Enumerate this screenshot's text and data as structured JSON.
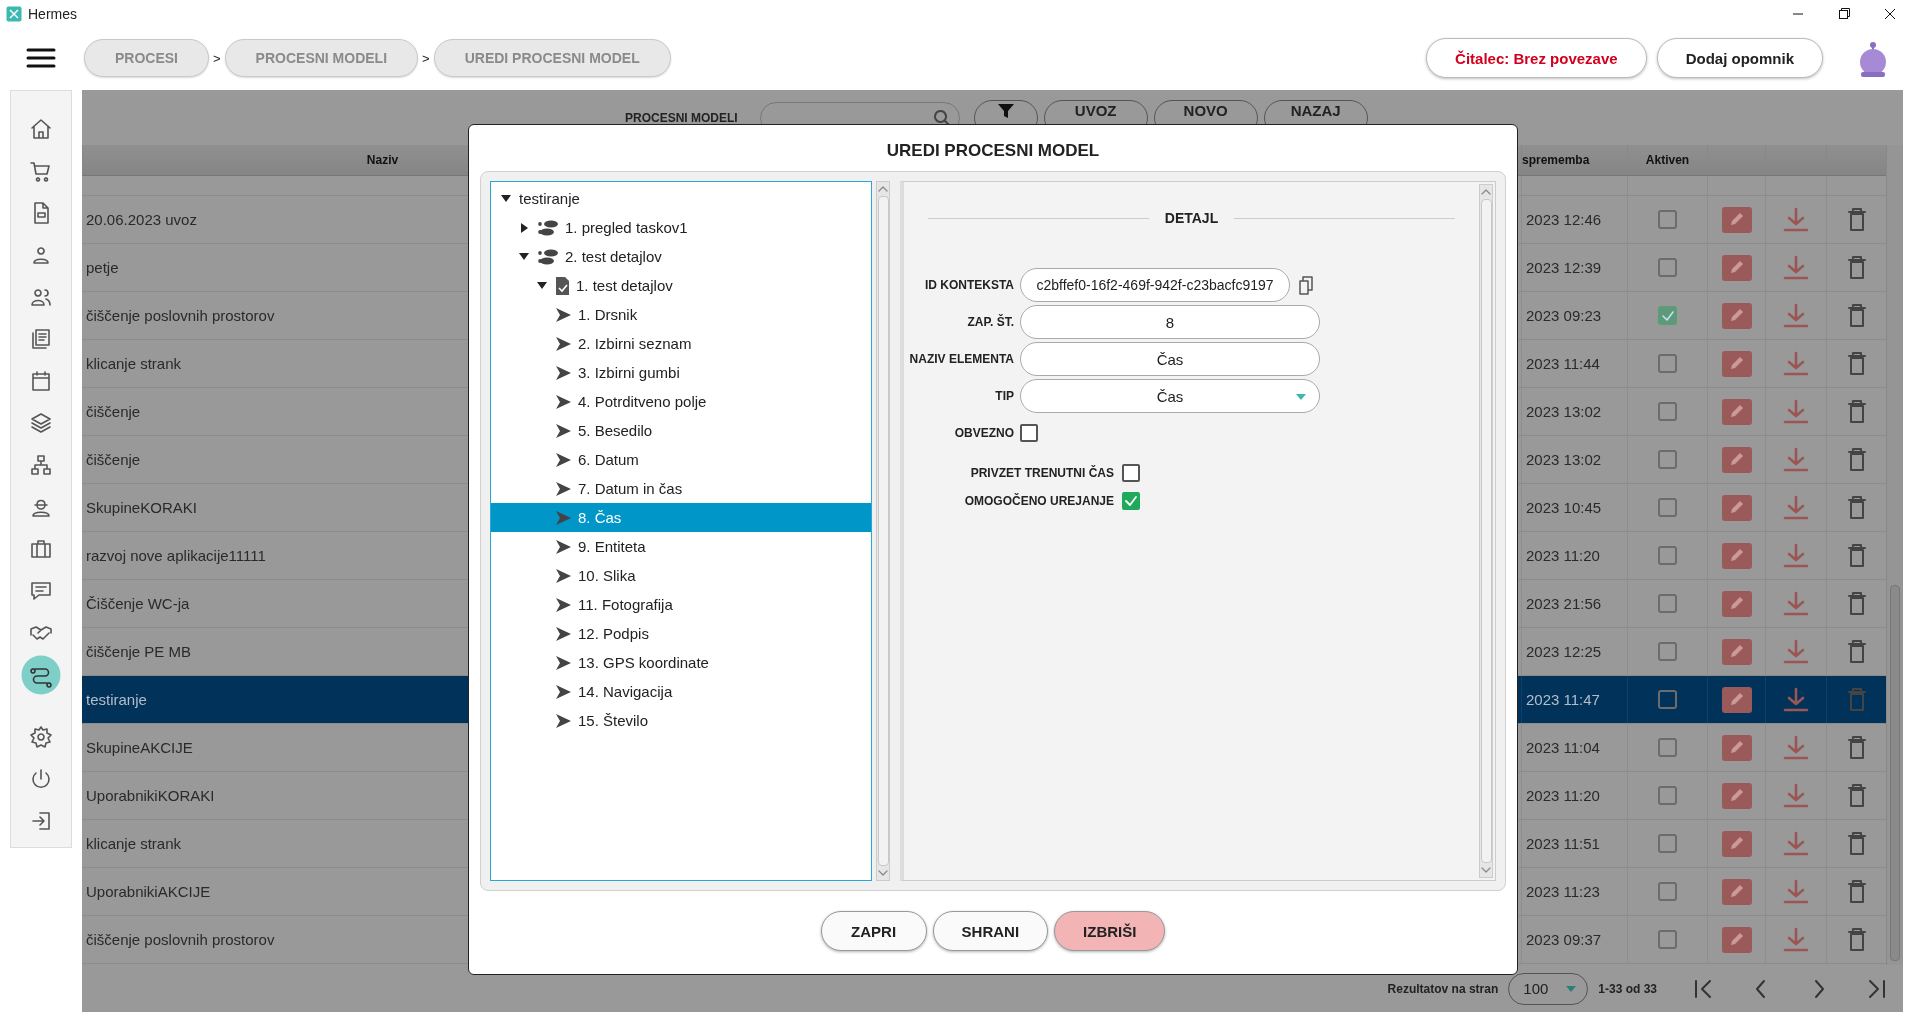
{
  "window": {
    "title": "Hermes"
  },
  "breadcrumbs": [
    {
      "label": "PROCESI"
    },
    {
      "separator": ">",
      "label": "PROCESNI MODELI"
    },
    {
      "separator": ">",
      "label": "UREDI PROCESNI MODEL"
    }
  ],
  "header_buttons": [
    {
      "label": "Čitalec: Brez povezave",
      "kind": "alert"
    },
    {
      "label": "Dodaj opomnik",
      "kind": "plain"
    }
  ],
  "sidebar": {
    "items": [
      {
        "selected": false
      },
      {
        "selected": false
      },
      {
        "selected": false
      },
      {
        "selected": false
      },
      {
        "selected": false
      },
      {
        "selected": false
      },
      {
        "selected": false
      },
      {
        "selected": false
      },
      {
        "selected": false
      },
      {
        "selected": false
      },
      {
        "selected": false
      },
      {
        "selected": false
      },
      {
        "selected": false
      },
      {
        "selected": true
      }
    ],
    "bottom_items": [
      {
        "selected": false
      },
      {
        "selected": false
      },
      {
        "selected": false
      }
    ]
  },
  "toolbar": {
    "label": "PROCESNI MODELI",
    "buttons": [
      "UVOZ",
      "NOVO",
      "NAZAJ"
    ]
  },
  "table": {
    "columns": [
      "Naziv",
      "sprememba",
      "Aktiven"
    ],
    "rows": [
      {
        "name": "20.06.2023 uvoz",
        "changed": "2023 12:46",
        "active": false,
        "selected": false
      },
      {
        "name": "petje",
        "changed": "2023 12:39",
        "active": false,
        "selected": false
      },
      {
        "name": "čiščenje poslovnih prostorov",
        "changed": "2023 09:23",
        "active": true,
        "selected": false
      },
      {
        "name": "klicanje strank",
        "changed": "2023 11:44",
        "active": false,
        "selected": false
      },
      {
        "name": "čiščenje",
        "changed": "2023 13:02",
        "active": false,
        "selected": false
      },
      {
        "name": "čiščenje",
        "changed": "2023 13:02",
        "active": false,
        "selected": false
      },
      {
        "name": "SkupineKORAKI",
        "changed": "2023 10:45",
        "active": false,
        "selected": false
      },
      {
        "name": "razvoj nove aplikacije11111",
        "changed": "2023 11:20",
        "active": false,
        "selected": false
      },
      {
        "name": "Čiščenje WC-ja",
        "changed": "2023 21:56",
        "active": false,
        "selected": false
      },
      {
        "name": "čiščenje PE MB",
        "changed": "2023 12:25",
        "active": false,
        "selected": false
      },
      {
        "name": "testiranje",
        "changed": "2023 11:47",
        "active": false,
        "selected": true
      },
      {
        "name": "SkupineAKCIJE",
        "changed": "2023 11:04",
        "active": false,
        "selected": false
      },
      {
        "name": "UporabnikiKORAKI",
        "changed": "2023 11:20",
        "active": false,
        "selected": false
      },
      {
        "name": "klicanje strank",
        "changed": "2023 11:51",
        "active": false,
        "selected": false
      },
      {
        "name": "UporabnikiAKCIJE",
        "changed": "2023 11:23",
        "active": false,
        "selected": false
      },
      {
        "name": "čiščenje poslovnih prostorov",
        "changed": "2023 09:37",
        "active": false,
        "selected": false
      }
    ]
  },
  "pagination": {
    "label": "Rezultatov na stran",
    "page_size": "100",
    "range": "1-33 od 33"
  },
  "dialog": {
    "title": "UREDI PROCESNI MODEL",
    "tree": [
      {
        "label": "testiranje",
        "expanded": true,
        "selected": false,
        "children": [
          {
            "label": "1. pregled taskov1",
            "kind": "step",
            "expanded": false,
            "selected": false
          },
          {
            "label": "2. test detajlov",
            "kind": "step",
            "expanded": true,
            "selected": false,
            "children": [
              {
                "label": "1. test detajlov",
                "kind": "form",
                "expanded": true,
                "selected": false,
                "children": [
                  {
                    "label": "1. Drsnik",
                    "kind": "element",
                    "selected": false
                  },
                  {
                    "label": "2. Izbirni seznam",
                    "kind": "element",
                    "selected": false
                  },
                  {
                    "label": "3. Izbirni gumbi",
                    "kind": "element",
                    "selected": false
                  },
                  {
                    "label": "4. Potrditveno polje",
                    "kind": "element",
                    "selected": false
                  },
                  {
                    "label": "5. Besedilo",
                    "kind": "element",
                    "selected": false
                  },
                  {
                    "label": "6. Datum",
                    "kind": "element",
                    "selected": false
                  },
                  {
                    "label": "7. Datum in čas",
                    "kind": "element",
                    "selected": false
                  },
                  {
                    "label": "8. Čas",
                    "kind": "element",
                    "selected": true
                  },
                  {
                    "label": "9. Entiteta",
                    "kind": "element",
                    "selected": false
                  },
                  {
                    "label": "10. Slika",
                    "kind": "element",
                    "selected": false
                  },
                  {
                    "label": "11. Fotografija",
                    "kind": "element",
                    "selected": false
                  },
                  {
                    "label": "12. Podpis",
                    "kind": "element",
                    "selected": false
                  },
                  {
                    "label": "13. GPS koordinate",
                    "kind": "element",
                    "selected": false
                  },
                  {
                    "label": "14. Navigacija",
                    "kind": "element",
                    "selected": false
                  },
                  {
                    "label": "15. Število",
                    "kind": "element",
                    "selected": false
                  }
                ]
              }
            ]
          }
        ]
      }
    ],
    "detail": {
      "title": "DETAJL",
      "fields": [
        {
          "label": "ID KONTEKSTA",
          "kind": "copy",
          "value": "c2bffef0-16f2-469f-942f-c23bacfc9197"
        },
        {
          "label": "ZAP. ŠT.",
          "kind": "text",
          "value": "8"
        },
        {
          "label": "NAZIV ELEMENTA",
          "kind": "text",
          "value": "Čas"
        },
        {
          "label": "TIP",
          "kind": "select",
          "value": "Čas"
        },
        {
          "label": "OBVEZNO",
          "kind": "checkbox",
          "checked": false
        }
      ],
      "options": [
        {
          "label": "PRIVZET TRENUTNI ČAS",
          "checked": false
        },
        {
          "label": "OMOGOČENO UREJANJE",
          "checked": true
        }
      ]
    },
    "buttons": [
      {
        "label": "ZAPRI",
        "kind": "plain"
      },
      {
        "label": "SHRANI",
        "kind": "plain"
      },
      {
        "label": "IZBRIŠI",
        "kind": "danger"
      }
    ]
  }
}
